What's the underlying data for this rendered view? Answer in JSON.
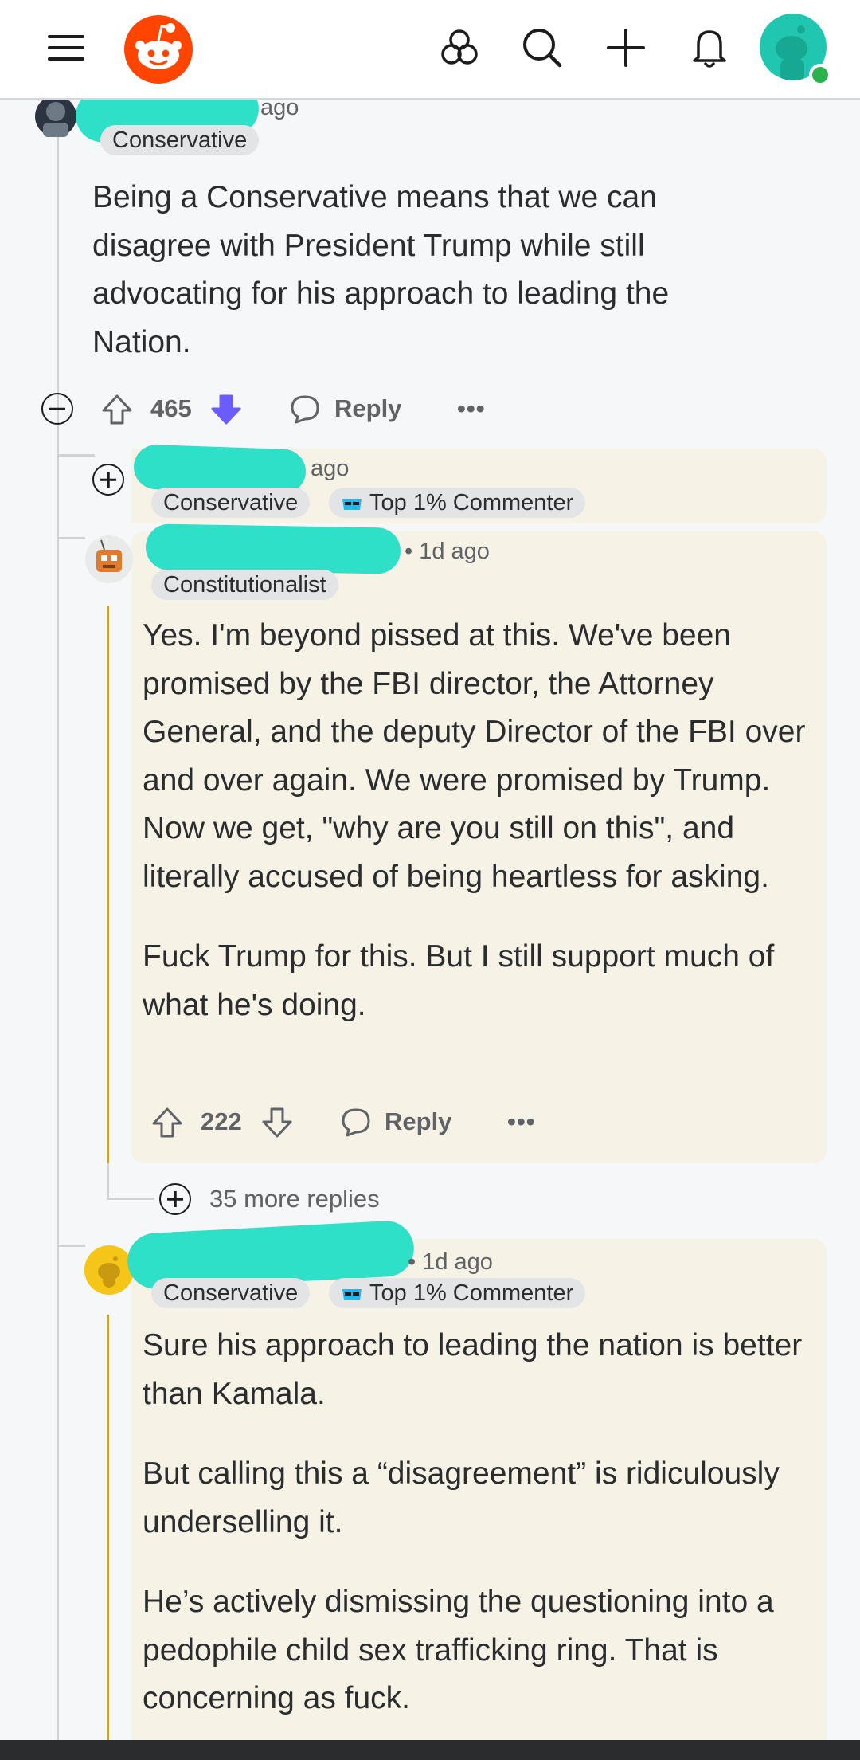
{
  "header": {
    "menu_icon": "hamburger-menu-icon",
    "logo_icon": "reddit-snoo-logo",
    "communities_icon": "communities-icon",
    "search_icon": "search-icon",
    "create_icon": "plus-icon",
    "notifications_icon": "bell-icon",
    "profile_icon": "user-avatar",
    "accent_color": "#ff4500",
    "avatar_color": "#21c6b0"
  },
  "comment1": {
    "time": "ago",
    "flair": "Conservative",
    "body": "Being a Conservative means that we can disagree with President Trump while still advocating for his approach to leading the Nation.",
    "votes": "465",
    "reply_label": "Reply",
    "more_label": "•••",
    "vote_state": "downvoted",
    "downvote_color": "#6a5cff"
  },
  "comment2": {
    "time": "ago",
    "flair": "Conservative",
    "badge": "Top 1% Commenter"
  },
  "comment3": {
    "time": "• 1d ago",
    "flair": "Constitutionalist",
    "paragraphs": [
      "Yes. I'm beyond pissed at this. We've been promised by the FBI director, the Attorney General, and the deputy Director of the FBI over and over again. We were promised by Trump. Now we get, \"why are you still on this\", and literally accused of being heartless for asking.",
      "Fuck Trump for this. But I still support much of what he's doing."
    ],
    "votes": "222",
    "reply_label": "Reply",
    "more_label": "•••",
    "more_replies": "35 more replies"
  },
  "comment4": {
    "time": "• 1d ago",
    "flair": "Conservative",
    "badge": "Top 1% Commenter",
    "paragraphs": [
      "Sure his approach to leading the nation is better than Kamala.",
      "But calling this a “disagreement” is ridiculously underselling it.",
      "He’s actively dismissing the questioning into a pedophile child sex trafficking ring. That is concerning as fuck."
    ]
  }
}
